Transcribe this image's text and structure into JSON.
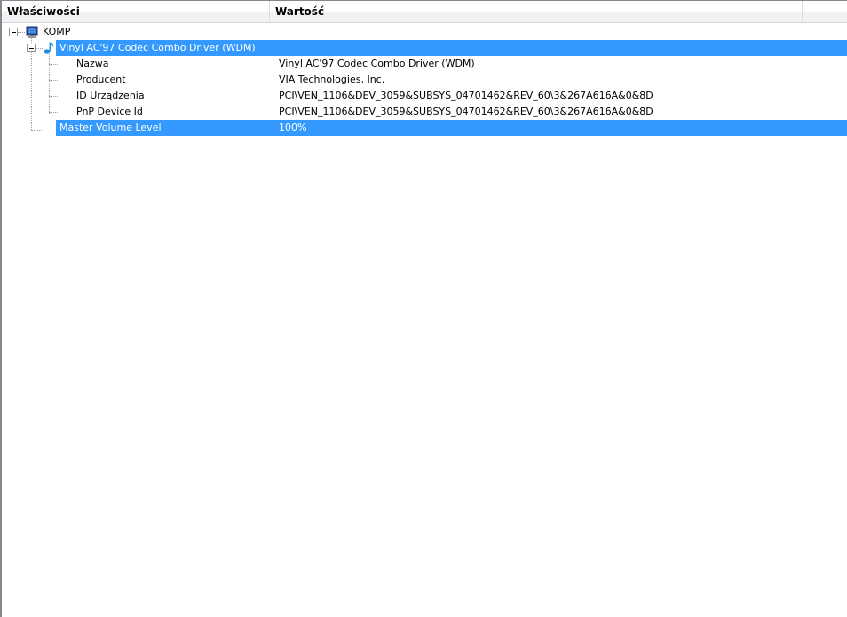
{
  "header": {
    "col_properties": "Właściwości",
    "col_value": "Wartość"
  },
  "tree": {
    "root": {
      "label": "KOMP",
      "icon": "computer-icon"
    },
    "device": {
      "label": "Vinyl AC'97 Codec Combo Driver (WDM)",
      "icon": "music-note-icon"
    },
    "properties": [
      {
        "name": "Nazwa",
        "value": "Vinyl AC'97 Codec Combo Driver (WDM)"
      },
      {
        "name": "Producent",
        "value": "VIA Technologies, Inc."
      },
      {
        "name": "ID Urządzenia",
        "value": "PCI\\VEN_1106&DEV_3059&SUBSYS_04701462&REV_60\\3&267A616A&0&8D"
      },
      {
        "name": "PnP Device Id",
        "value": "PCI\\VEN_1106&DEV_3059&SUBSYS_04701462&REV_60\\3&267A616A&0&8D"
      }
    ],
    "master": {
      "name": "Master Volume Level",
      "value": "100%"
    }
  },
  "colors": {
    "selection": "#3399ff",
    "border": "#828790"
  }
}
